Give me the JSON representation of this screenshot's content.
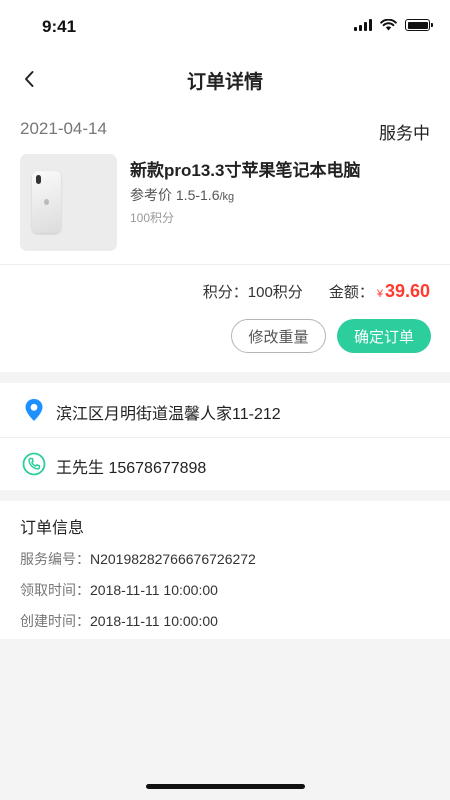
{
  "status_bar": {
    "time": "9:41"
  },
  "nav": {
    "title": "订单详情",
    "back_icon": "chevron-left-icon"
  },
  "order": {
    "date": "2021-04-14",
    "status": "服务中",
    "product": {
      "title": "新款pro13.3寸苹果笔记本电脑",
      "ref_price_prefix": "参考价 ",
      "ref_price": "1.5-1.6",
      "ref_price_unit": "/kg",
      "points": "100积分"
    },
    "summary": {
      "points_label": "积分：",
      "points_value": "100积分",
      "amount_label": "金额：",
      "currency": "¥",
      "amount": "39.60"
    },
    "buttons": {
      "modify": "修改重量",
      "confirm": "确定订单"
    }
  },
  "contact": {
    "address": "滨江区月明街道温馨人家11-212",
    "name_phone": "王先生 15678677898",
    "address_icon": "location-pin-icon",
    "phone_icon": "phone-icon"
  },
  "info": {
    "title": "订单信息",
    "rows": [
      {
        "label": "服务编号：",
        "value": "N20198282766676726272"
      },
      {
        "label": "领取时间：",
        "value": "2018-11-11 10:00:00"
      },
      {
        "label": "创建时间：",
        "value": "2018-11-11 10:00:00"
      }
    ]
  },
  "colors": {
    "accent": "#2cce9e",
    "price": "#ff3b30",
    "location_icon": "#1e90ff",
    "phone_icon": "#2cce9e",
    "background": "#f4f4f4"
  }
}
